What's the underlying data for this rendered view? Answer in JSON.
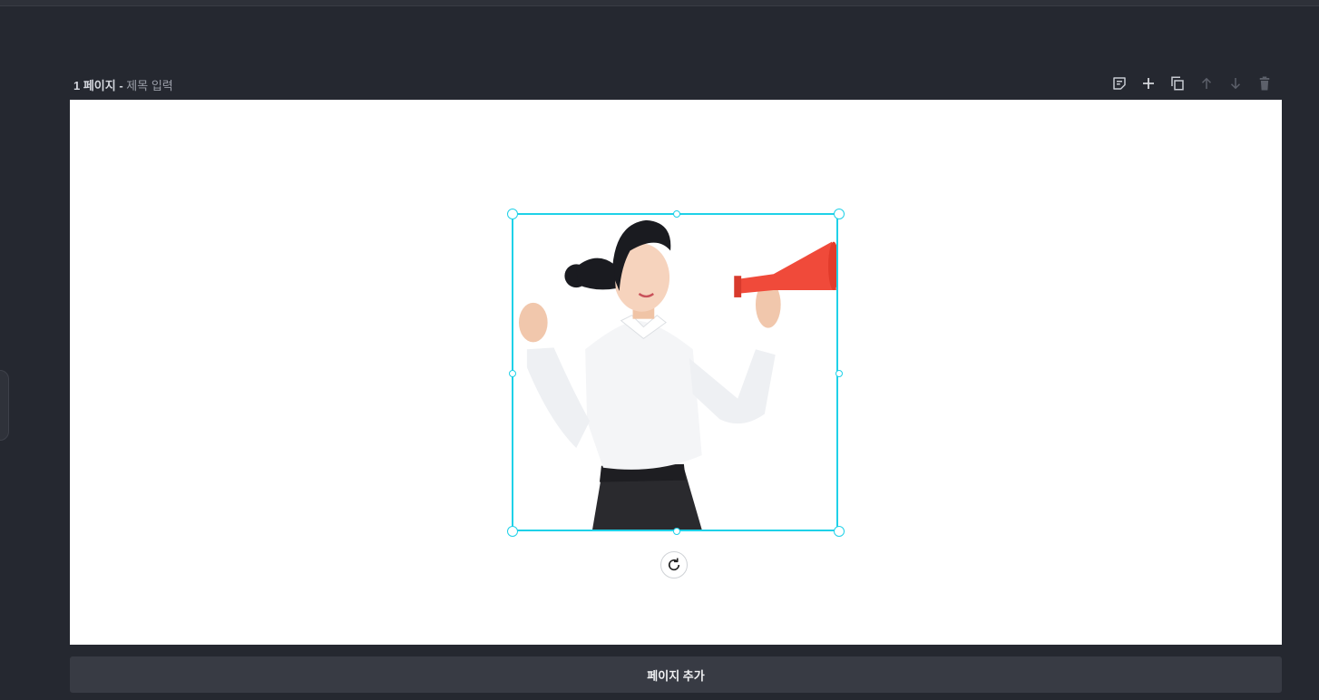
{
  "page": {
    "number_label": "1 페이지 -",
    "title_placeholder": "제목 입력"
  },
  "toolbar": {
    "items": [
      {
        "icon": "note-icon",
        "enabled": true
      },
      {
        "icon": "plus-icon",
        "enabled": true
      },
      {
        "icon": "copy-icon",
        "enabled": true
      },
      {
        "icon": "arrow-up-icon",
        "enabled": false
      },
      {
        "icon": "arrow-down-icon",
        "enabled": false
      },
      {
        "icon": "trash-icon",
        "enabled": false
      }
    ]
  },
  "canvas": {
    "selected_element": "image",
    "selection_color": "#1fd1e8"
  },
  "add_page_button": {
    "label": "페이지 추가"
  }
}
